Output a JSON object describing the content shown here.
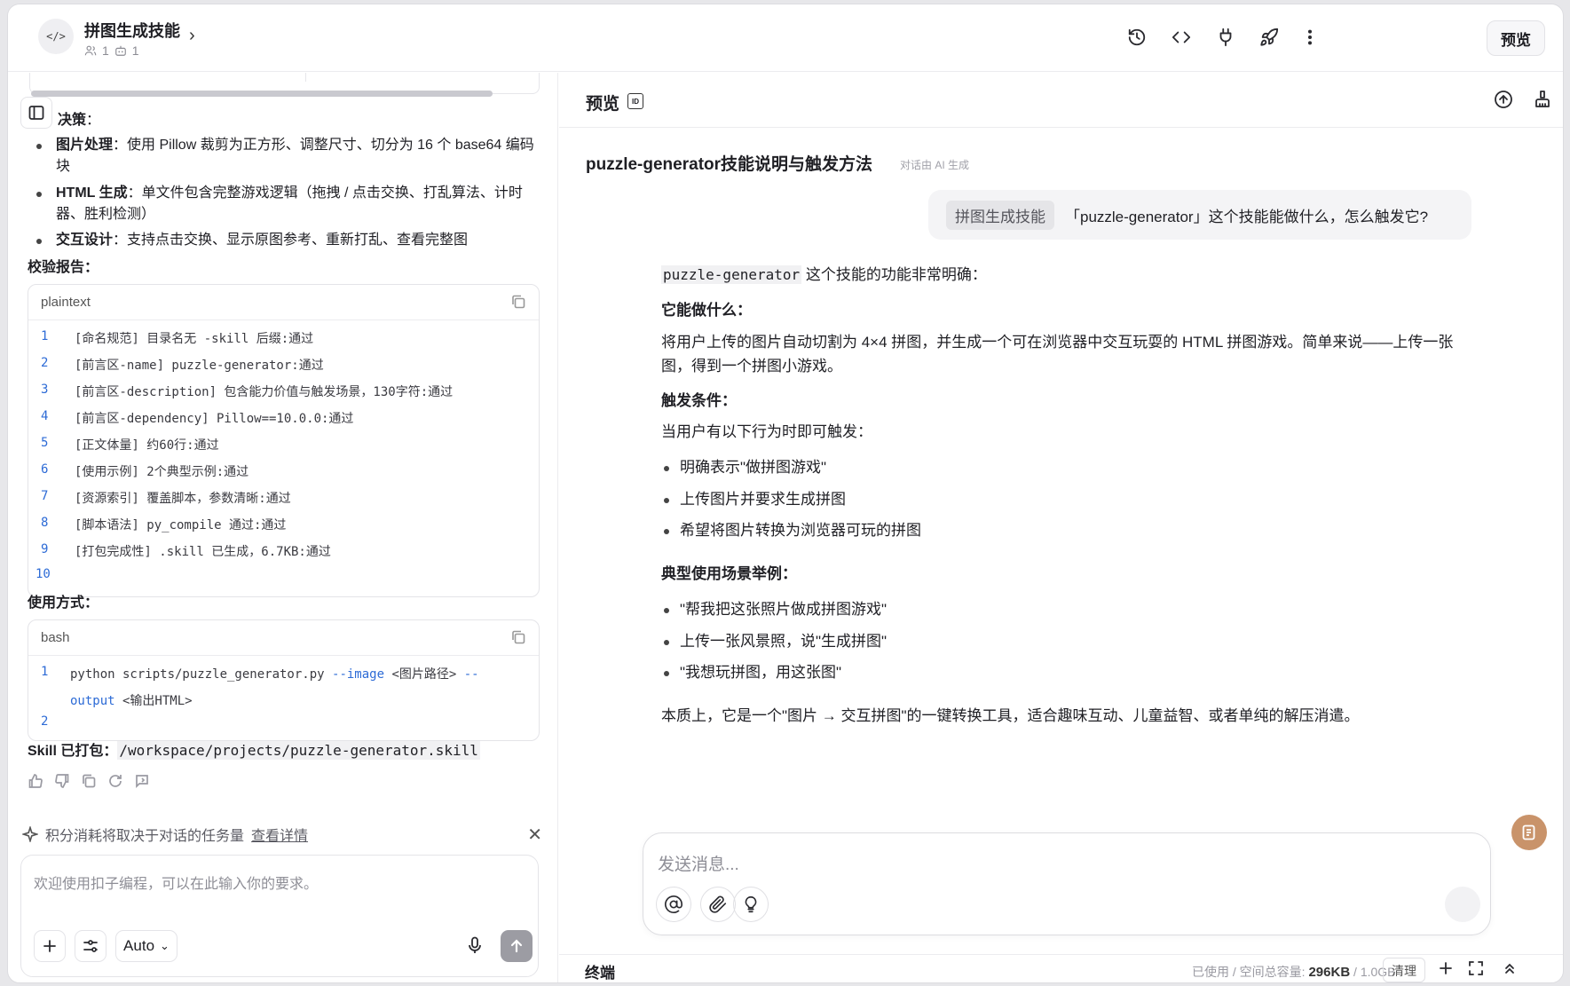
{
  "header": {
    "project_icon": "</>",
    "project_title": "拼图生成技能",
    "member_count": "1",
    "bot_count": "1",
    "preview_label": "预览",
    "icons": [
      "history-icon",
      "code-icon",
      "plug-icon",
      "rocket-icon",
      "more-vertical-icon"
    ]
  },
  "left": {
    "decision_heading": "决策",
    "decision_heading_suffix": "：",
    "decisions": [
      {
        "label": "图片处理",
        "text": "：使用 Pillow 裁剪为正方形、调整尺寸、切分为 16 个 base64 编码块"
      },
      {
        "label": "HTML 生成",
        "text": "：单文件包含完整游戏逻辑（拖拽 / 点击交换、打乱算法、计时器、胜利检测）"
      },
      {
        "label": "交互设计",
        "text": "：支持点击交换、显示原图参考、重新打乱、查看完整图"
      }
    ],
    "report_heading": "校验报告：",
    "report_lang": "plaintext",
    "report_lines": [
      "[命名规范] 目录名无 -skill 后缀:通过",
      "[前言区-name] puzzle-generator:通过",
      "[前言区-description] 包含能力价值与触发场景，130字符:通过",
      "[前言区-dependency] Pillow==10.0.0:通过",
      "[正文体量] 约60行:通过",
      "[使用示例] 2个典型示例:通过",
      "[资源索引] 覆盖脚本，参数清晰:通过",
      "[脚本语法] py_compile 通过:通过",
      "[打包完成性] .skill 已生成，6.7KB:通过",
      ""
    ],
    "usage_heading": "使用方式：",
    "usage_lang": "bash",
    "usage_line1_prefix": "python scripts/puzzle_generator.py ",
    "usage_line1_flag": "--image",
    "usage_line1_arg": " <图片路径> ",
    "usage_line1_flag2": "--",
    "usage_line1b_flag": "output",
    "usage_line1b_arg": " <输出HTML>",
    "packed_label": "Skill 已打包：",
    "packed_path": "/workspace/projects/puzzle-generator.skill",
    "notice_text": "积分消耗将取决于对话的任务量",
    "notice_link": "查看详情",
    "input_placeholder": "欢迎使用扣子编程，可以在此输入你的要求。",
    "mode_label": "Auto"
  },
  "right": {
    "panel_title": "预览",
    "conversation_title": "puzzle-generator技能说明与触发方法",
    "conversation_sub": "对话由 AI 生成",
    "user_tag": "拼图生成技能",
    "user_message": "「puzzle-generator」这个技能能做什么，怎么触发它?",
    "intro_code": "puzzle-generator",
    "intro_text": " 这个技能的功能非常明确：",
    "h_what": "它能做什么：",
    "what_line1": "将用户上传的图片自动切割为 4×4 拼图，并生成一个可在浏览器中交互玩耍的 HTML 拼图游戏。简单来说——上传一张",
    "what_line2": "图，得到一个拼图小游戏。",
    "h_trigger": "触发条件：",
    "trigger_intro": "当用户有以下行为时即可触发：",
    "triggers": [
      "明确表示\"做拼图游戏\"",
      "上传图片并要求生成拼图",
      "希望将图片转换为浏览器可玩的拼图"
    ],
    "h_examples": "典型使用场景举例：",
    "examples": [
      "\"帮我把这张照片做成拼图游戏\"",
      "上传一张风景照，说\"生成拼图\"",
      "\"我想玩拼图，用这张图\""
    ],
    "summary": "本质上，它是一个\"图片 → 交互拼图\"的一键转换工具，适合趣味互动、儿童益智、或者单纯的解压消遣。",
    "composer_placeholder": "发送消息...",
    "terminal_label": "终端",
    "usage_prefix": "已使用 / 空间总容量: ",
    "usage_used": "296KB",
    "usage_sep": " / ",
    "usage_total": "1.0GB",
    "clear_label": "清理"
  },
  "colors": {
    "accent_blue": "#2d6bd6",
    "floating_button": "#c9936a",
    "send_disabled": "#9c9ca3"
  }
}
